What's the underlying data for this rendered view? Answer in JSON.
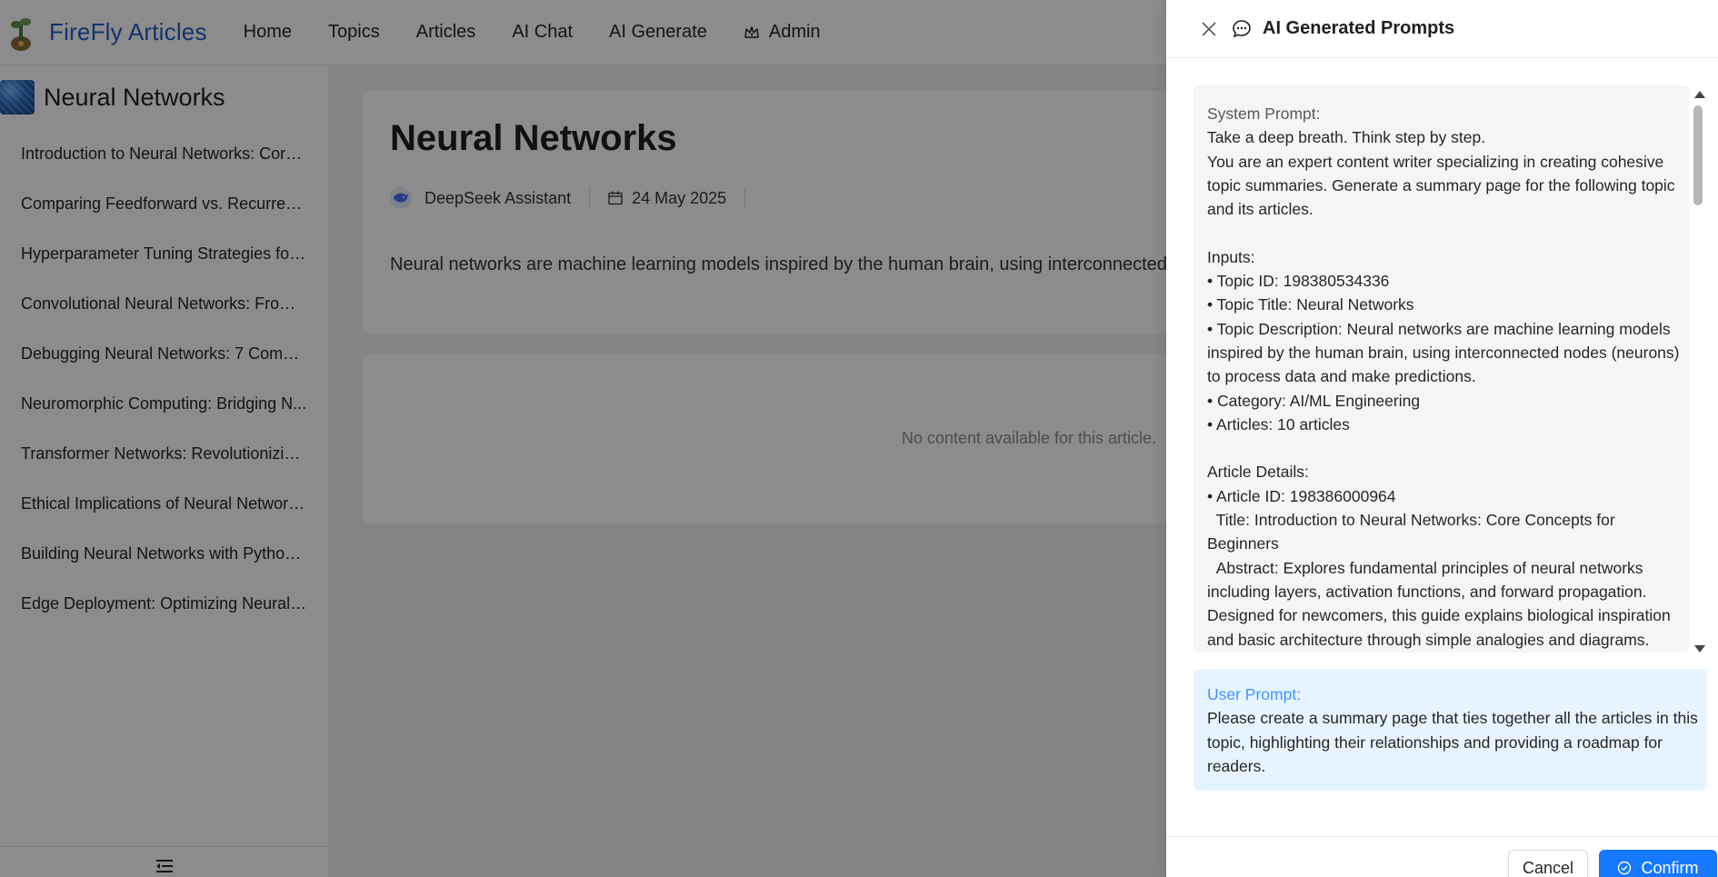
{
  "nav": {
    "brand": "FireFly Articles",
    "items": [
      "Home",
      "Topics",
      "Articles",
      "AI Chat",
      "AI Generate",
      "Admin"
    ]
  },
  "sidebar": {
    "title": "Neural Networks",
    "items": [
      "Introduction to Neural Networks: Core ...",
      "Comparing Feedforward vs. Recurrent ...",
      "Hyperparameter Tuning Strategies for ...",
      "Convolutional Neural Networks: From ...",
      "Debugging Neural Networks: 7 Comm...",
      "Neuromorphic Computing: Bridging N...",
      "Transformer Networks: Revolutionizing...",
      "Ethical Implications of Neural Network ...",
      "Building Neural Networks with Python ...",
      "Edge Deployment: Optimizing Neural ..."
    ]
  },
  "article": {
    "title": "Neural Networks",
    "author": "DeepSeek Assistant",
    "date": "24 May 2025",
    "description": "Neural networks are machine learning models inspired by the human brain, using interconnected",
    "empty_message": "No content available for this article."
  },
  "drawer": {
    "title": "AI Generated Prompts",
    "system_label": "System Prompt:",
    "system_lines": [
      "Take a deep breath. Think step by step.",
      "You are an expert content writer specializing in creating cohesive topic summaries. Generate a summary page for the following topic and its articles.",
      "",
      "Inputs:",
      "• Topic ID: 198380534336",
      "• Topic Title: Neural Networks",
      "• Topic Description: Neural networks are machine learning models inspired by the human brain, using interconnected nodes (neurons) to process data and make predictions.",
      "• Category: AI/ML Engineering",
      "• Articles: 10 articles",
      "",
      "Article Details:",
      "• Article ID: 198386000964",
      "  Title: Introduction to Neural Networks: Core Concepts for Beginners",
      "  Abstract: Explores fundamental principles of neural networks including layers, activation functions, and forward propagation. Designed for newcomers, this guide explains biological inspiration and basic architecture through simple analogies and diagrams."
    ],
    "user_label": "User Prompt:",
    "user_text": "Please create a summary page that ties together all the articles in this topic, highlighting their relationships and providing a roadmap for readers.",
    "cancel_label": "Cancel",
    "confirm_label": "Confirm"
  },
  "colors": {
    "brand": "#1f5fc4",
    "primary": "#1677ff",
    "user_prompt_bg": "#e6f4ff",
    "system_prompt_bg": "#f5f5f5"
  }
}
